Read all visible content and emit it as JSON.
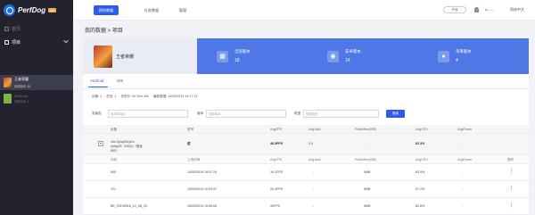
{
  "brand": {
    "name": "PerfDog",
    "badge": "VIP"
  },
  "sidebar": {
    "home": "首页",
    "project": "项目",
    "apps": [
      {
        "name": "王者荣耀",
        "sub": "安卓版本: 18",
        "active": true
      },
      {
        "name": "PerfDog",
        "sub": "苹果版本: 4",
        "active": false
      }
    ]
  },
  "topbar": {
    "tabs": [
      "我的数据",
      "任务数据",
      "管理"
    ],
    "pill": "开放",
    "user": "a------",
    "lang": "简体中文"
  },
  "breadcrumb": "我的数据 > 项目",
  "banner": {
    "game_title": "王者荣耀",
    "stats": [
      {
        "label": "全部版本",
        "value": "18",
        "icon": "all-versions-icon"
      },
      {
        "label": "安卓版本",
        "value": "14",
        "icon": "android-icon"
      },
      {
        "label": "苹果版本",
        "value": "4",
        "icon": "apple-icon"
      }
    ]
  },
  "platform_tabs": [
    "Android",
    "iOS"
  ],
  "meta": [
    "设备: 1",
    "任务: 1",
    "总时长: 0h 30m 49s",
    "最新数据: 14/05/2019 15:17:13"
  ],
  "filters": {
    "version_label": "安装包",
    "version_placeholder": "选择安装包",
    "version2_label": "版本",
    "version2_placeholder": "选择版本",
    "model_label": "机型",
    "model_placeholder": "搜索机型",
    "search_btn": "搜索"
  },
  "table": {
    "headers": [
      "设备",
      "型号",
      "AvgFPS",
      "AvgJank",
      "PeakMem(MB)",
      "AvgCPU",
      "AvgPower"
    ],
    "group": {
      "device": "vivo Xplay3S(vivo Xplay3S（V3QL）/骁龙800）",
      "model": "否",
      "avgfps": "40.3FPS",
      "avgjank": "0.0",
      "peakmem": "-",
      "avgcpu": "62.3%",
      "avgpower": "-"
    },
    "sub_headers": [
      "内存",
      "上传时间",
      "AvgFPS",
      "AvgJank",
      "PeakMem(MB)",
      "AvgCPU",
      "AvgPower",
      "操作"
    ],
    "rows": [
      {
        "name": "545",
        "time": "14/05/2019 15:07:24",
        "fps": "34.1FPS",
        "jank": "-",
        "mem": "0MB",
        "cpu": "63.5%",
        "power": "-"
      },
      {
        "name": "121",
        "time": "13/09/2019 10:03:37",
        "fps": "50.4FPS",
        "jank": "-",
        "mem": "0MB",
        "cpu": "57.2%",
        "power": "-"
      },
      {
        "name": "BE_20190516_10_58_03",
        "time": "16/05/2019 10:59:06",
        "fps": "40FPS",
        "jank": "-",
        "mem": "0MB",
        "cpu": "62.6%",
        "power": "-"
      }
    ]
  },
  "colors": {
    "accent": "#2f5bea",
    "banner": "#4f78e6",
    "sidebar": "#23232f"
  }
}
